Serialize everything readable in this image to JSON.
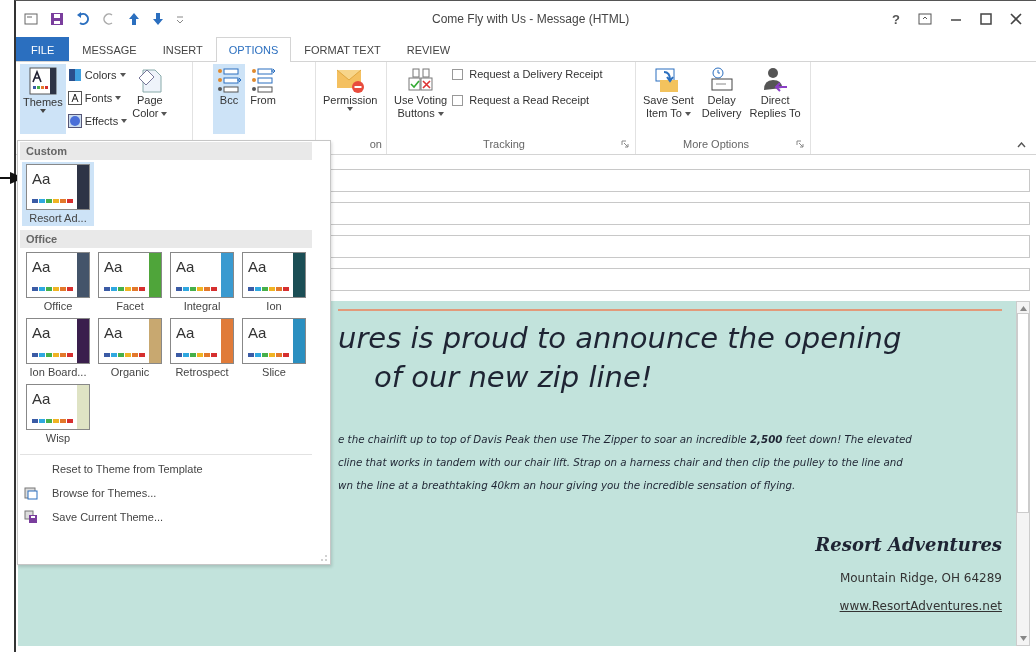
{
  "window": {
    "title": "Come Fly with Us - Message (HTML)",
    "help": "?"
  },
  "tabs": [
    {
      "label": "FILE",
      "kind": "file",
      "selected": false
    },
    {
      "label": "MESSAGE",
      "kind": "tab",
      "selected": false
    },
    {
      "label": "INSERT",
      "kind": "tab",
      "selected": false
    },
    {
      "label": "OPTIONS",
      "kind": "tab",
      "selected": true
    },
    {
      "label": "FORMAT TEXT",
      "kind": "tab",
      "selected": false
    },
    {
      "label": "REVIEW",
      "kind": "tab",
      "selected": false
    }
  ],
  "ribbon": {
    "themes": {
      "label": "Themes",
      "small": [
        {
          "label": "Colors",
          "kind": "colors"
        },
        {
          "label": "Fonts",
          "kind": "fonts"
        },
        {
          "label": "Effects",
          "kind": "effects"
        }
      ],
      "page_color": [
        "Page",
        "Color"
      ]
    },
    "fields": [
      {
        "label": "Bcc",
        "kind": "bcc",
        "selected": true
      },
      {
        "label": "From",
        "kind": "from",
        "selected": false
      }
    ],
    "permission": {
      "label": "Permission",
      "group_label": "on"
    },
    "tracking": {
      "voting": [
        "Use Voting",
        "Buttons"
      ],
      "checkboxes": [
        {
          "label": "Request a Delivery Receipt",
          "checked": false
        },
        {
          "label": "Request a Read Receipt",
          "checked": false
        }
      ],
      "group_label": "Tracking"
    },
    "more_options": {
      "buttons": [
        {
          "lines": [
            "Save Sent",
            "Item To"
          ],
          "kind": "save",
          "dropdown": true
        },
        {
          "lines": [
            "Delay",
            "Delivery"
          ],
          "kind": "delay",
          "dropdown": false
        },
        {
          "lines": [
            "Direct",
            "Replies To"
          ],
          "kind": "direct",
          "dropdown": false
        }
      ],
      "group_label": "More Options"
    }
  },
  "theme_menu": {
    "sections": [
      {
        "heading": "Custom",
        "themes": [
          {
            "name": "Resort Ad...",
            "sample": "Aa",
            "color": "#2e3446",
            "selected": true
          }
        ]
      },
      {
        "heading": "Office",
        "themes": [
          {
            "name": "Office",
            "sample": "Aa",
            "color": "#44546a",
            "selected": false
          },
          {
            "name": "Facet",
            "sample": "Aa",
            "color": "#4fa53a",
            "selected": false
          },
          {
            "name": "Integral",
            "sample": "Aa",
            "color": "#3a9ad0",
            "selected": false
          },
          {
            "name": "Ion",
            "sample": "Aa",
            "color": "#1b4e55",
            "selected": false
          },
          {
            "name": "Ion Board...",
            "sample": "Aa",
            "color": "#3a1f4d",
            "selected": false
          },
          {
            "name": "Organic",
            "sample": "Aa",
            "color": "#c8a870",
            "selected": false
          },
          {
            "name": "Retrospect",
            "sample": "Aa",
            "color": "#e07b39",
            "selected": false
          },
          {
            "name": "Slice",
            "sample": "Aa",
            "color": "#2a8fc0",
            "selected": false
          },
          {
            "name": "Wisp",
            "sample": "Aa",
            "color": "#dfe3c4",
            "selected": false
          }
        ]
      }
    ],
    "commands": [
      {
        "label": "Reset to Theme from Template",
        "kind": "reset"
      },
      {
        "label": "Browse for Themes...",
        "kind": "browse"
      },
      {
        "label": "Save Current Theme...",
        "kind": "save"
      }
    ]
  },
  "message": {
    "headline": [
      "ures is proud to announce the opening",
      "of our new zip line!"
    ],
    "paragraph": [
      "e the chairlift up to top of Davis Peak then use The Zipper to soar an incredible **2,500** feet down! The elevated",
      "cline that works in tandem with our chair lift.  Strap on a harness chair and then clip the pulley to the line and",
      "wn the line at a breathtaking 40km an hour giving you the incredible sensation of flying."
    ],
    "signature": {
      "name": "Resort Adventures",
      "address": "Mountain Ridge, OH 64289",
      "link": "www.ResortAdventures.net"
    }
  }
}
